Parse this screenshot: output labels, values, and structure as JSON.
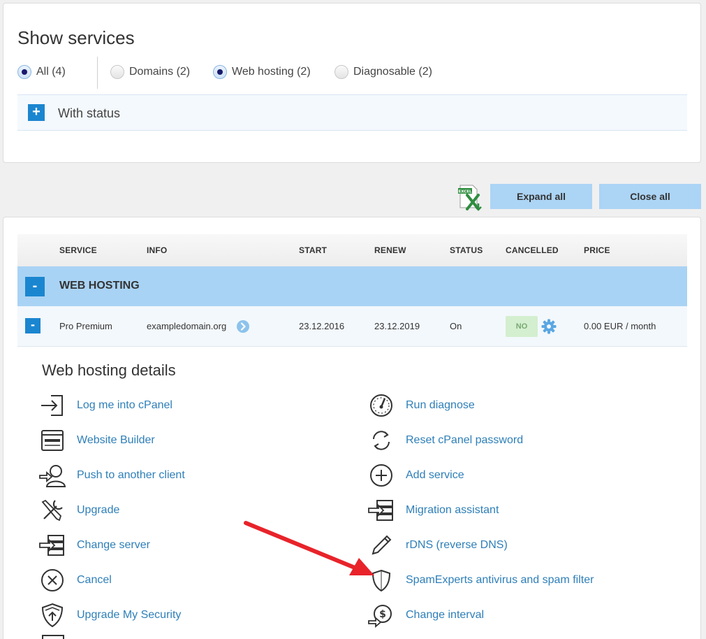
{
  "filter": {
    "title": "Show services",
    "options": [
      {
        "label": "All (4)",
        "checked": true
      },
      {
        "label": "Domains (2)",
        "checked": false
      },
      {
        "label": "Web hosting (2)",
        "checked": true
      },
      {
        "label": "Diagnosable (2)",
        "checked": false
      }
    ],
    "status_toggle": "+",
    "status_label": "With status"
  },
  "actions": {
    "excel_icon_text": "EXCEL",
    "expand_all": "Expand all",
    "close_all": "Close all"
  },
  "table": {
    "headers": [
      "SERVICE",
      "INFO",
      "START",
      "RENEW",
      "STATUS",
      "CANCELLED",
      "PRICE"
    ],
    "group": {
      "toggle": "-",
      "label": "WEB HOSTING"
    },
    "row": {
      "toggle": "-",
      "service": "Pro Premium",
      "info": "exampledomain.org",
      "start": "23.12.2016",
      "renew": "23.12.2019",
      "status": "On",
      "cancelled": "NO",
      "price": "0.00 EUR / month"
    }
  },
  "details": {
    "title": "Web hosting details",
    "left": [
      {
        "label": "Log me into cPanel",
        "icon": "login-icon"
      },
      {
        "label": "Website Builder",
        "icon": "website-builder-icon"
      },
      {
        "label": "Push to another client",
        "icon": "push-client-icon"
      },
      {
        "label": "Upgrade",
        "icon": "tools-icon"
      },
      {
        "label": "Change server",
        "icon": "server-icon"
      },
      {
        "label": "Cancel",
        "icon": "cancel-icon"
      },
      {
        "label": "Upgrade My Security",
        "icon": "security-upgrade-icon"
      }
    ],
    "right": [
      {
        "label": "Run diagnose",
        "icon": "gauge-icon"
      },
      {
        "label": "Reset cPanel password",
        "icon": "refresh-icon"
      },
      {
        "label": "Add service",
        "icon": "add-icon"
      },
      {
        "label": "Migration assistant",
        "icon": "migration-icon"
      },
      {
        "label": "rDNS (reverse DNS)",
        "icon": "pencil-icon"
      },
      {
        "label": "SpamExperts antivirus and spam filter",
        "icon": "shield-icon"
      },
      {
        "label": "Change interval",
        "icon": "interval-icon"
      }
    ]
  },
  "colors": {
    "accent_blue": "#1b86d0",
    "link_blue": "#2e7fb8",
    "group_row": "#a9d3f4",
    "annotation_arrow": "#e8232a"
  }
}
